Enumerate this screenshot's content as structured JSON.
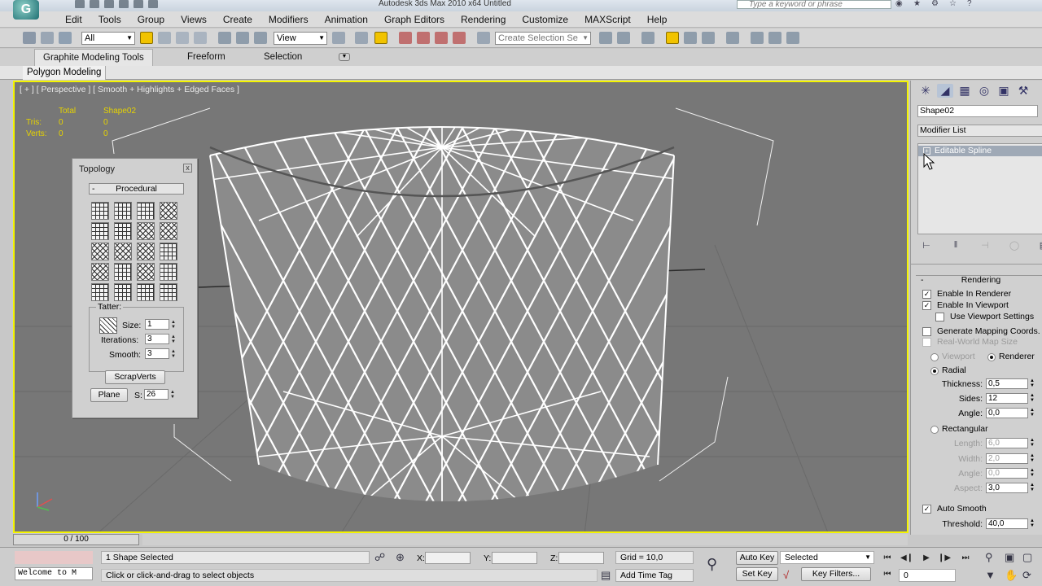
{
  "titlebar": {
    "app_logo": "G",
    "title": "Autodesk 3ds Max  2010 x64      Untitled",
    "search_placeholder": "Type a keyword or phrase"
  },
  "menu": [
    "Edit",
    "Tools",
    "Group",
    "Views",
    "Create",
    "Modifiers",
    "Animation",
    "Graph Editors",
    "Rendering",
    "Customize",
    "MAXScript",
    "Help"
  ],
  "toolbar": {
    "selection_filter": "All",
    "ref_coord": "View",
    "named_selection_placeholder": "Create Selection Se"
  },
  "ribbon": {
    "tabs": [
      "Graphite Modeling Tools",
      "Freeform",
      "Selection"
    ],
    "subtab": "Polygon Modeling"
  },
  "viewport": {
    "label": "[ + ] [ Perspective ] [ Smooth + Highlights + Edged Faces ]",
    "stats": {
      "col_total": "Total",
      "col_object": "Shape02",
      "rows": [
        {
          "label": "Tris:",
          "total": "0",
          "object": "0"
        },
        {
          "label": "Verts:",
          "total": "0",
          "object": "0"
        }
      ]
    }
  },
  "topology": {
    "title": "Topology",
    "close": "x",
    "procedural_label": "Procedural",
    "tatter_label": "Tatter:",
    "size_label": "Size:",
    "size_value": "1",
    "iterations_label": "Iterations:",
    "iterations_value": "3",
    "smooth_label": "Smooth:",
    "smooth_value": "3",
    "scrapverts_label": "ScrapVerts",
    "plane_label": "Plane",
    "s_label": "S:",
    "s_value": "26"
  },
  "command_panel": {
    "object_name": "Shape02",
    "modifier_list": "Modifier List",
    "stack_item": "Editable Spline",
    "rendering_title": "Rendering",
    "enable_renderer": "Enable In Renderer",
    "enable_viewport": "Enable In Viewport",
    "use_viewport_settings": "Use Viewport Settings",
    "generate_mapping": "Generate Mapping Coords.",
    "real_world": "Real-World Map Size",
    "viewport_radio": "Viewport",
    "renderer_radio": "Renderer",
    "radial": "Radial",
    "thickness_label": "Thickness:",
    "thickness_value": "0,5",
    "sides_label": "Sides:",
    "sides_value": "12",
    "angle_label": "Angle:",
    "angle_value": "0,0",
    "rectangular": "Rectangular",
    "length_label": "Length:",
    "length_value": "6,0",
    "width_label": "Width:",
    "width_value": "2,0",
    "angle2_label": "Angle:",
    "angle2_value": "0,0",
    "aspect_label": "Aspect:",
    "aspect_value": "3,0",
    "auto_smooth": "Auto Smooth",
    "threshold_label": "Threshold:",
    "threshold_value": "40,0"
  },
  "timeslider": {
    "label": "0 / 100"
  },
  "status": {
    "maxscript": "Welcome to M",
    "selection_info": "1 Shape Selected",
    "prompt": "Click or click-and-drag to select objects",
    "x_label": "X:",
    "y_label": "Y:",
    "z_label": "Z:",
    "grid": "Grid = 10,0",
    "add_time_tag": "Add Time Tag",
    "auto_key": "Auto Key",
    "selected": "Selected",
    "set_key": "Set Key",
    "key_filters": "Key Filters...",
    "frame": "0"
  }
}
